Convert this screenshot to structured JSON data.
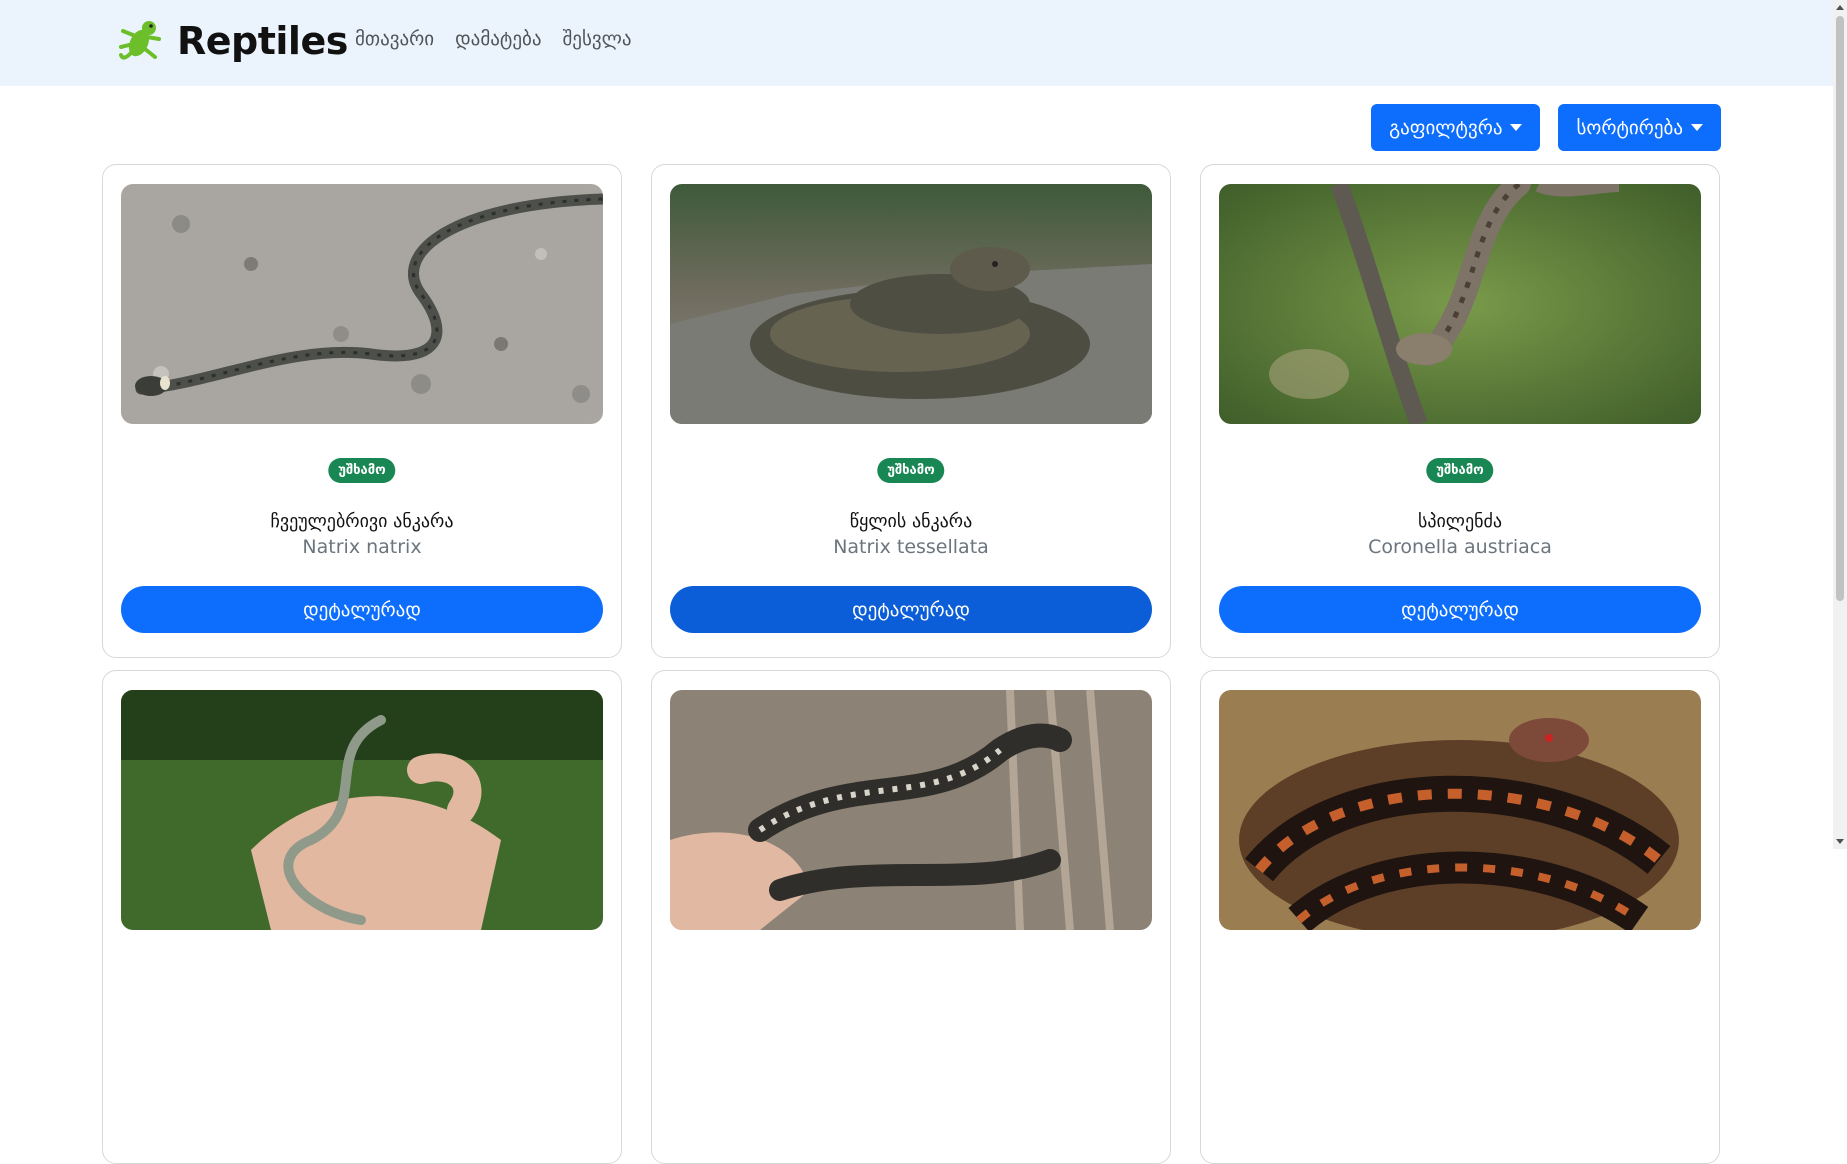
{
  "header": {
    "brand": "Reptiles",
    "nav": [
      {
        "label": "მთავარი"
      },
      {
        "label": "დამატება"
      },
      {
        "label": "შესვლა"
      }
    ]
  },
  "toolbar": {
    "filter_label": "გაფილტვრა",
    "sort_label": "სორტირება"
  },
  "cards": [
    {
      "badge": "უშხამო",
      "name": "ჩვეულებრივი ანკარა",
      "latin": "Natrix natrix",
      "button": "დეტალურად",
      "image": "snake-on-gravel"
    },
    {
      "badge": "უშხამო",
      "name": "წყლის ანკარა",
      "latin": "Natrix tessellata",
      "button": "დეტალურად",
      "image": "snake-coiled-on-rock"
    },
    {
      "badge": "უშხამო",
      "name": "სპილენძა",
      "latin": "Coronella austriaca",
      "button": "დეტალურად",
      "image": "snake-on-branch"
    },
    {
      "image": "snake-in-hand"
    },
    {
      "image": "spotted-snake-in-hand"
    },
    {
      "image": "orange-viper-coiled"
    }
  ],
  "colors": {
    "primary": "#0d6efd",
    "success": "#198754",
    "navbar_bg": "#ebf4fd"
  }
}
